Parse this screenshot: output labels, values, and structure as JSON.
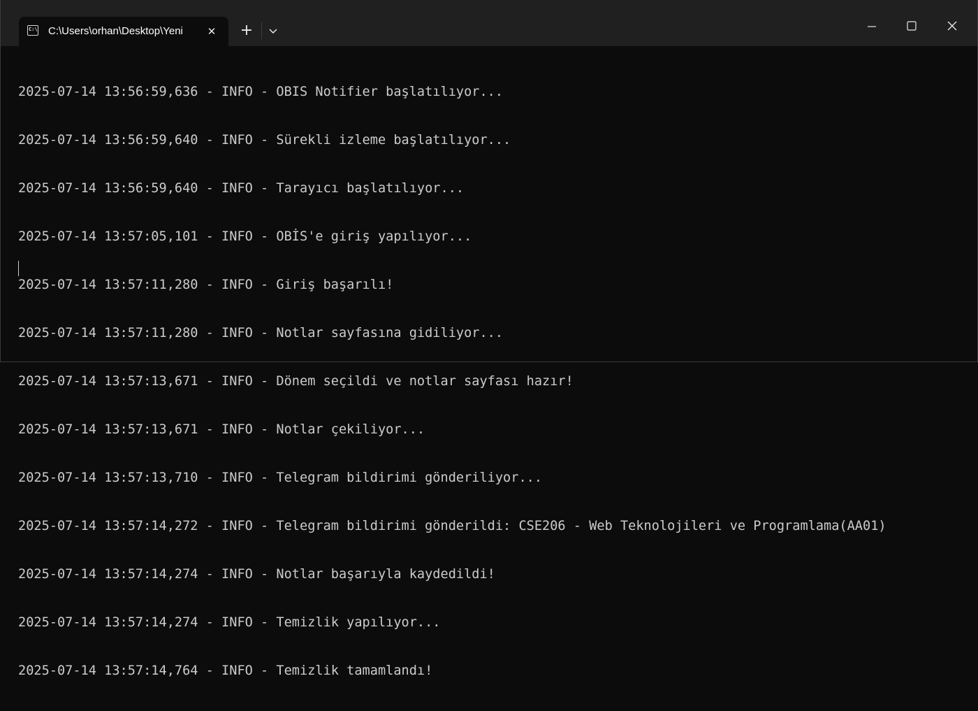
{
  "window": {
    "tab_title": "C:\\Users\\orhan\\Desktop\\Yeni",
    "tab_icon": "terminal-icon",
    "tab_icon_glyph": "C:\\",
    "close_tab_glyph": "✕",
    "new_tab_glyph": "+",
    "dropdown_icon": "chevron-down-icon",
    "minimize_icon": "minimize-icon",
    "maximize_icon": "maximize-icon",
    "close_icon": "close-icon"
  },
  "terminal": {
    "lines": [
      "2025-07-14 13:56:59,636 - INFO - OBIS Notifier başlatılıyor...",
      "2025-07-14 13:56:59,640 - INFO - Sürekli izleme başlatılıyor...",
      "2025-07-14 13:56:59,640 - INFO - Tarayıcı başlatılıyor...",
      "2025-07-14 13:57:05,101 - INFO - OBİS'e giriş yapılıyor...",
      "2025-07-14 13:57:11,280 - INFO - Giriş başarılı!",
      "2025-07-14 13:57:11,280 - INFO - Notlar sayfasına gidiliyor...",
      "2025-07-14 13:57:13,671 - INFO - Dönem seçildi ve notlar sayfası hazır!",
      "2025-07-14 13:57:13,671 - INFO - Notlar çekiliyor...",
      "2025-07-14 13:57:13,710 - INFO - Telegram bildirimi gönderiliyor...",
      "2025-07-14 13:57:14,272 - INFO - Telegram bildirimi gönderildi: CSE206 - Web Teknolojileri ve Programlama(AA01)",
      "2025-07-14 13:57:14,274 - INFO - Notlar başarıyla kaydedildi!",
      "2025-07-14 13:57:14,274 - INFO - Temizlik yapılıyor...",
      "2025-07-14 13:57:14,764 - INFO - Temizlik tamamlandı!"
    ]
  },
  "colors": {
    "terminal_bg": "#0c0c0c",
    "titlebar_bg": "#202020",
    "text": "#cccccc"
  }
}
